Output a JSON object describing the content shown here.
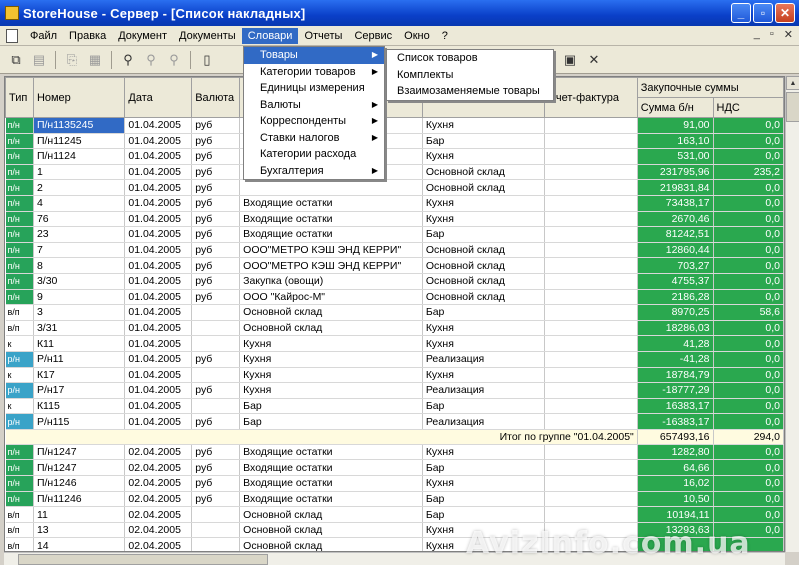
{
  "window": {
    "title": "StoreHouse - Сервер - [Список накладных]"
  },
  "menubar": {
    "items": [
      "Файл",
      "Правка",
      "Документ",
      "Документы",
      "Словари",
      "Отчеты",
      "Сервис",
      "Окно",
      "?"
    ],
    "active_index": 4,
    "mdi_buttons": [
      "_",
      "▫",
      "✕"
    ]
  },
  "dropdown_main": {
    "items": [
      {
        "label": "Товары",
        "submenu": true
      },
      {
        "label": "Категории товаров",
        "submenu": true
      },
      {
        "label": "Единицы измерения",
        "submenu": false
      },
      {
        "label": "Валюты",
        "submenu": true
      },
      {
        "label": "Корреспонденты",
        "submenu": true
      },
      {
        "label": "Ставки налогов",
        "submenu": true
      },
      {
        "label": "Категории расхода",
        "submenu": false
      },
      {
        "label": "Бухгалтерия",
        "submenu": true
      }
    ],
    "highlighted_index": 0
  },
  "dropdown_sub": {
    "items": [
      "Список товаров",
      "Комплекты",
      "Взаимозаменяемые товары"
    ]
  },
  "grid": {
    "headers": {
      "type": "Тип",
      "number": "Номер",
      "date": "Дата",
      "currency": "Валюта",
      "invoice": "Счет-фактура",
      "group_purchase": "Закупочные суммы",
      "sum_wo_vat": "Сумма б/н",
      "vat": "НДС"
    },
    "rows": [
      {
        "type": "п/н",
        "num": "П/н1135245",
        "date": "01.04.2005",
        "cur": "руб",
        "from": "",
        "to": "Кухня",
        "inv": "",
        "sum": "91,00",
        "vat": "0,0",
        "sel": true
      },
      {
        "type": "п/н",
        "num": "П/н11245",
        "date": "01.04.2005",
        "cur": "руб",
        "from": "",
        "to": "Бар",
        "inv": "",
        "sum": "163,10",
        "vat": "0,0"
      },
      {
        "type": "п/н",
        "num": "П/н1124",
        "date": "01.04.2005",
        "cur": "руб",
        "from": "",
        "to": "Кухня",
        "inv": "",
        "sum": "531,00",
        "vat": "0,0"
      },
      {
        "type": "п/н",
        "num": "1",
        "date": "01.04.2005",
        "cur": "руб",
        "from": "",
        "to": "Основной склад",
        "inv": "",
        "sum": "231795,96",
        "vat": "235,2"
      },
      {
        "type": "п/н",
        "num": "2",
        "date": "01.04.2005",
        "cur": "руб",
        "from": "",
        "to": "Основной склад",
        "inv": "",
        "sum": "219831,84",
        "vat": "0,0"
      },
      {
        "type": "п/н",
        "num": "4",
        "date": "01.04.2005",
        "cur": "руб",
        "from": "Входящие остатки",
        "to": "Кухня",
        "inv": "",
        "sum": "73438,17",
        "vat": "0,0"
      },
      {
        "type": "п/н",
        "num": "76",
        "date": "01.04.2005",
        "cur": "руб",
        "from": "Входящие остатки",
        "to": "Кухня",
        "inv": "",
        "sum": "2670,46",
        "vat": "0,0"
      },
      {
        "type": "п/н",
        "num": "23",
        "date": "01.04.2005",
        "cur": "руб",
        "from": "Входящие остатки",
        "to": "Бар",
        "inv": "",
        "sum": "81242,51",
        "vat": "0,0"
      },
      {
        "type": "п/н",
        "num": "7",
        "date": "01.04.2005",
        "cur": "руб",
        "from": "ООО\"МЕТРО КЭШ ЭНД КЕРРИ\"",
        "to": "Основной склад",
        "inv": "",
        "sum": "12860,44",
        "vat": "0,0"
      },
      {
        "type": "п/н",
        "num": "8",
        "date": "01.04.2005",
        "cur": "руб",
        "from": "ООО\"МЕТРО КЭШ ЭНД КЕРРИ\"",
        "to": "Основной склад",
        "inv": "",
        "sum": "703,27",
        "vat": "0,0"
      },
      {
        "type": "п/н",
        "num": "3/30",
        "date": "01.04.2005",
        "cur": "руб",
        "from": "Закупка (овощи)",
        "to": "Основной склад",
        "inv": "",
        "sum": "4755,37",
        "vat": "0,0"
      },
      {
        "type": "п/н",
        "num": "9",
        "date": "01.04.2005",
        "cur": "руб",
        "from": "ООО \"Кайрос-М\"",
        "to": "Основной склад",
        "inv": "",
        "sum": "2186,28",
        "vat": "0,0"
      },
      {
        "type": "в/п",
        "num": "3",
        "date": "01.04.2005",
        "cur": "",
        "from": "Основной склад",
        "to": "Бар",
        "inv": "",
        "sum": "8970,25",
        "vat": "58,6"
      },
      {
        "type": "в/п",
        "num": "3/31",
        "date": "01.04.2005",
        "cur": "",
        "from": "Основной склад",
        "to": "Кухня",
        "inv": "",
        "sum": "18286,03",
        "vat": "0,0"
      },
      {
        "type": "к",
        "num": "К11",
        "date": "01.04.2005",
        "cur": "",
        "from": "Кухня",
        "to": "Кухня",
        "inv": "",
        "sum": "41,28",
        "vat": "0,0"
      },
      {
        "type": "р/н",
        "num": "Р/н11",
        "date": "01.04.2005",
        "cur": "руб",
        "from": "Кухня",
        "to": "Реализация",
        "inv": "",
        "sum": "-41,28",
        "vat": "0,0"
      },
      {
        "type": "к",
        "num": "К17",
        "date": "01.04.2005",
        "cur": "",
        "from": "Кухня",
        "to": "Кухня",
        "inv": "",
        "sum": "18784,79",
        "vat": "0,0"
      },
      {
        "type": "р/н",
        "num": "Р/н17",
        "date": "01.04.2005",
        "cur": "руб",
        "from": "Кухня",
        "to": "Реализация",
        "inv": "",
        "sum": "-18777,29",
        "vat": "0,0"
      },
      {
        "type": "к",
        "num": "К115",
        "date": "01.04.2005",
        "cur": "",
        "from": "Бар",
        "to": "Бар",
        "inv": "",
        "sum": "16383,17",
        "vat": "0,0"
      },
      {
        "type": "р/н",
        "num": "Р/н115",
        "date": "01.04.2005",
        "cur": "руб",
        "from": "Бар",
        "to": "Реализация",
        "inv": "",
        "sum": "-16383,17",
        "vat": "0,0"
      }
    ],
    "total": {
      "label": "Итог по группе \"01.04.2005\"",
      "sum": "657493,16",
      "vat": "294,0"
    },
    "rows2": [
      {
        "type": "п/н",
        "num": "П/н1247",
        "date": "02.04.2005",
        "cur": "руб",
        "from": "Входящие остатки",
        "to": "Кухня",
        "inv": "",
        "sum": "1282,80",
        "vat": "0,0"
      },
      {
        "type": "п/н",
        "num": "П/н1247",
        "date": "02.04.2005",
        "cur": "руб",
        "from": "Входящие остатки",
        "to": "Бар",
        "inv": "",
        "sum": "64,66",
        "vat": "0,0"
      },
      {
        "type": "п/н",
        "num": "П/н1246",
        "date": "02.04.2005",
        "cur": "руб",
        "from": "Входящие остатки",
        "to": "Кухня",
        "inv": "",
        "sum": "16,02",
        "vat": "0,0"
      },
      {
        "type": "п/н",
        "num": "П/н11246",
        "date": "02.04.2005",
        "cur": "руб",
        "from": "Входящие остатки",
        "to": "Бар",
        "inv": "",
        "sum": "10,50",
        "vat": "0,0"
      },
      {
        "type": "в/п",
        "num": "11",
        "date": "02.04.2005",
        "cur": "",
        "from": "Основной склад",
        "to": "Бар",
        "inv": "",
        "sum": "10194,11",
        "vat": "0,0"
      },
      {
        "type": "в/п",
        "num": "13",
        "date": "02.04.2005",
        "cur": "",
        "from": "Основной склад",
        "to": "Кухня",
        "inv": "",
        "sum": "13293,63",
        "vat": "0,0"
      },
      {
        "type": "в/п",
        "num": "14",
        "date": "02.04.2005",
        "cur": "",
        "from": "Основной склад",
        "to": "Кухня",
        "inv": "",
        "sum": "",
        "vat": ""
      }
    ]
  },
  "watermark": "AvizInfo.com.ua",
  "icons": [
    "app-icon",
    "document-icon",
    "copy-icon",
    "paste-icon",
    "find-icon",
    "delete-icon",
    "properties-icon"
  ]
}
